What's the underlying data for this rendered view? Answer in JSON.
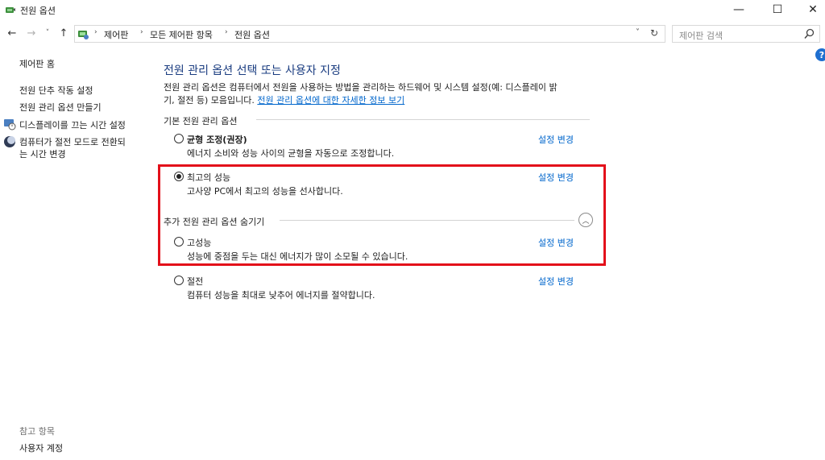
{
  "window": {
    "title": "전원 옵션",
    "minimize": "—",
    "maximize": "☐",
    "close": "✕"
  },
  "nav": {
    "back": "←",
    "forward": "→",
    "recent": "˅",
    "up": "↑",
    "breadcrumbs": [
      "제어판",
      "모든 제어판 항목",
      "전원 옵션"
    ],
    "separator": "›",
    "dropdown": "˅",
    "refresh": "↻"
  },
  "search": {
    "placeholder": "제어판 검색"
  },
  "help": "?",
  "sidebar": {
    "home": "제어판 홈",
    "items": [
      {
        "label": "전원 단추 작동 설정"
      },
      {
        "label": "전원 관리 옵션 만들기"
      },
      {
        "label": "디스플레이를 끄는 시간 설정"
      },
      {
        "label_line1": "컴퓨터가 절전 모드로 전환되",
        "label_line2": "는 시간 변경"
      }
    ],
    "see_also_title": "참고 항목",
    "see_also_items": [
      "사용자 계정"
    ]
  },
  "main": {
    "title": "전원 관리 옵션 선택 또는 사용자 지정",
    "description": "전원 관리 옵션은 컴퓨터에서 전원을 사용하는 방법을 관리하는 하드웨어 및 시스템 설정(예: 디스플레이 밝기, 절전 등) 모음입니다.",
    "description_part1": "전원 관리 옵션은 컴퓨터에서 전원을 사용하는 방법을 관리하는 하드웨어 및 시스템 설정(예: 디스플레이 밝",
    "description_part2": "기, 절전 등) 모음입니다. ",
    "description_link": "전원 관리 옵션에 대한 자세한 정보 보기",
    "group_basic": "기본 전원 관리 옵션",
    "group_additional": "추가 전원 관리 옵션 숨기기",
    "change_label": "설정 변경",
    "plans": [
      {
        "name": "균형 조정(권장)",
        "desc": "에너지 소비와 성능 사이의 균형을 자동으로 조정합니다.",
        "selected": false
      },
      {
        "name": "최고의 성능",
        "desc": "고사양 PC에서 최고의 성능을 선사합니다.",
        "selected": true
      },
      {
        "name": "고성능",
        "desc": "성능에 중점을 두는 대신 에너지가 많이 소모될 수 있습니다.",
        "selected": false
      },
      {
        "name": "절전",
        "desc": "컴퓨터 성능을 최대로 낮추어 에너지를 절약합니다.",
        "selected": false
      }
    ]
  },
  "colors": {
    "highlight": "#e3101a",
    "link": "#0066cc",
    "title": "#1a3c80"
  }
}
